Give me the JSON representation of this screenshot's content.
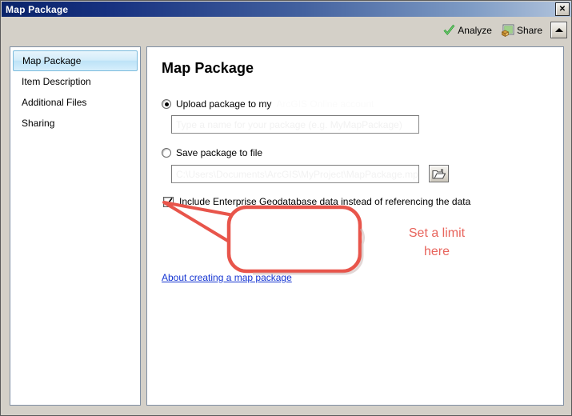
{
  "window": {
    "title": "Map Package",
    "close_label": "✕"
  },
  "toolbar": {
    "analyze_label": "Analyze",
    "share_label": "Share",
    "collapse_label": ""
  },
  "sidebar": {
    "items": [
      {
        "label": "Map Package",
        "selected": true
      },
      {
        "label": "Item Description",
        "selected": false
      },
      {
        "label": "Additional Files",
        "selected": false
      },
      {
        "label": "Sharing",
        "selected": false
      }
    ]
  },
  "main": {
    "heading": "Map Package",
    "upload_option": {
      "label": "Upload package to my",
      "label_faint": "ArcGIS Online account",
      "selected": true,
      "textbox_value": "Type a name for your package (e.g. MyMapPackage)",
      "textbox_placeholder": ""
    },
    "save_option": {
      "label": "Save package to file",
      "selected": false,
      "textbox_value": "C:\\Users\\Documents\\ArcGIS\\MyProject\\MapPackage.mpk",
      "textbox_placeholder": "",
      "browse_icon": "open-folder-icon"
    },
    "include_checkbox": {
      "label": "Include Enterprise Geodatabase data instead of referencing the data",
      "checked": true
    },
    "help_link": "About creating a map package"
  },
  "annotation": {
    "callout_line1": "Set a limit",
    "callout_line2": "here",
    "color": "#e8645c"
  }
}
